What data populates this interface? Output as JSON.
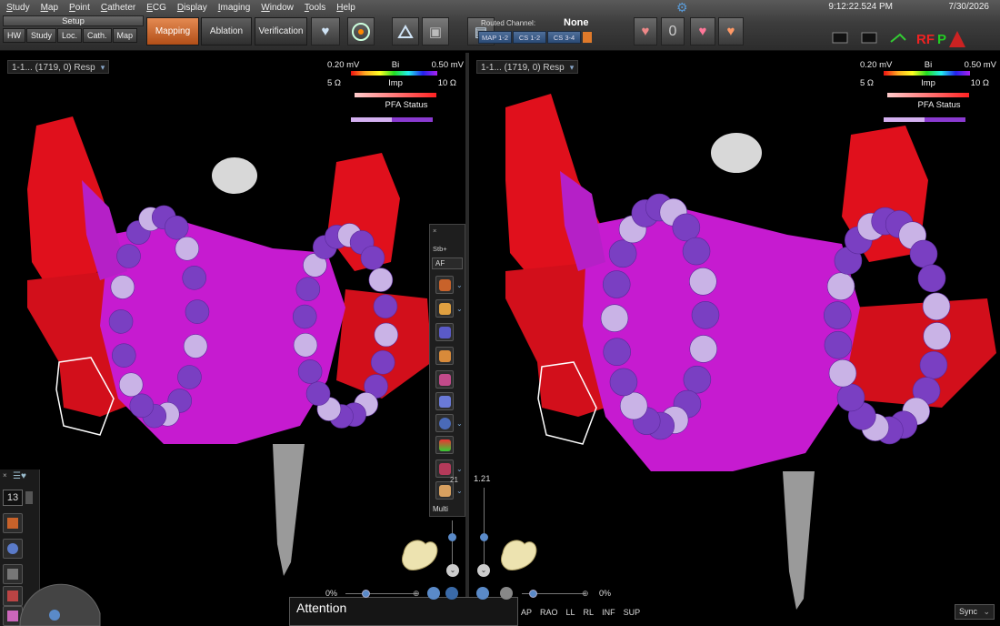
{
  "menu": [
    "Study",
    "Map",
    "Point",
    "Catheter",
    "ECG",
    "Display",
    "Imaging",
    "Window",
    "Tools",
    "Help"
  ],
  "clock": "9:12:22.524 PM",
  "date": "7/30/2026",
  "setup": {
    "title": "Setup",
    "buttons": [
      "HW",
      "Study",
      "Loc.",
      "Cath.",
      "Map"
    ]
  },
  "modes": {
    "mapping": "Mapping",
    "ablation": "Ablation",
    "verification": "Verification",
    "active": "Mapping"
  },
  "routed": {
    "label": "Routed Channel:",
    "value": "None",
    "channels": [
      "MAP 1-2",
      "CS 1-2",
      "CS 3-4"
    ]
  },
  "counter": "0",
  "left_view": {
    "label": "1-1... (1719, 0) Resp",
    "bi": {
      "min": "0.20 mV",
      "name": "Bi",
      "max": "0.50 mV"
    },
    "imp": {
      "min": "5 Ω",
      "name": "Imp",
      "max": "10 Ω"
    },
    "pfa": "PFA Status"
  },
  "right_view": {
    "label": "1-1... (1719, 0) Resp",
    "bi": {
      "min": "0.20 mV",
      "name": "Bi",
      "max": "0.50 mV"
    },
    "imp": {
      "min": "5 Ω",
      "name": "Imp",
      "max": "10 Ω"
    },
    "pfa": "PFA Status"
  },
  "float_toolbar": {
    "top_label": "Stb+",
    "dropdown": "AF",
    "bottom_label": "Multi"
  },
  "left_tools": {
    "value": "13"
  },
  "attention": "Attention",
  "zoom_left": "0%",
  "zoom_right": "0%",
  "slider_value": "1.21",
  "slider_value_small": "21",
  "view_buttons": [
    "AP",
    "RAO",
    "LL",
    "RL",
    "INF",
    "SUP"
  ],
  "sync": "Sync",
  "colors": {
    "accent": "#c8622a",
    "chamber_magenta": "#c61bd0",
    "vein_red": "#e0101c",
    "lesion_dark": "#7a3fc2",
    "lesion_light": "#c9b3e6"
  },
  "icons": [
    "heart-icon",
    "catheter-icon",
    "tilt-icon",
    "camera-icon",
    "monitor-icon",
    "gear-icon",
    "heart-model-icon"
  ]
}
